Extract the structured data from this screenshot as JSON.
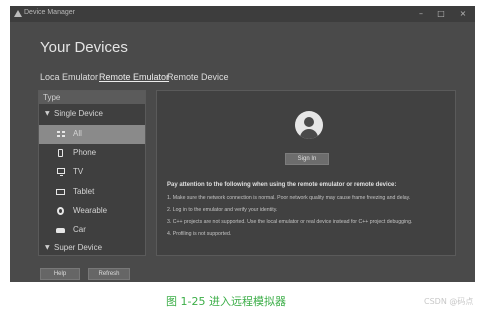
{
  "window": {
    "title": "Device Manager",
    "controls": {
      "minimize": "–",
      "maximize": "□",
      "close": "×"
    }
  },
  "heading": "Your Devices",
  "tabs": [
    {
      "label": "Loca Emulator",
      "active": false
    },
    {
      "label": "Remote Emulator",
      "active": true
    },
    {
      "label": "Remote Device",
      "active": false
    }
  ],
  "sidebar": {
    "header": "Type",
    "groups": [
      {
        "label": "Single Device",
        "expanded": true
      },
      {
        "label": "Super Device",
        "expanded": true
      }
    ],
    "items": [
      {
        "label": "All",
        "icon": "grid-icon",
        "selected": true
      },
      {
        "label": "Phone",
        "icon": "phone-icon",
        "selected": false
      },
      {
        "label": "TV",
        "icon": "tv-icon",
        "selected": false
      },
      {
        "label": "Tablet",
        "icon": "tablet-icon",
        "selected": false
      },
      {
        "label": "Wearable",
        "icon": "watch-icon",
        "selected": false
      },
      {
        "label": "Car",
        "icon": "car-icon",
        "selected": false
      }
    ]
  },
  "main": {
    "avatar_icon": "user-avatar-icon",
    "sign_in_label": "Sign In",
    "notice_title": "Pay attention to the following when using the remote emulator or remote device:",
    "notices": [
      "1. Make sure the network connection is normal. Poor network quality may cause frame freezing and delay.",
      "2. Log in to the emulator and verify your identity.",
      "3. C++ projects are not supported. Use the local emulator or real device instead for C++ project debugging.",
      "4. Profiling is not supported."
    ]
  },
  "footer": {
    "help_label": "Help",
    "refresh_label": "Refresh"
  },
  "caption": "图 1-25  进入远程模拟器",
  "watermark": "CSDN @码点",
  "colors": {
    "window_bg": "#4a4a4a",
    "panel_bg": "#414141",
    "selected_row": "#8a8a8a",
    "caption_green": "#3cae48"
  }
}
